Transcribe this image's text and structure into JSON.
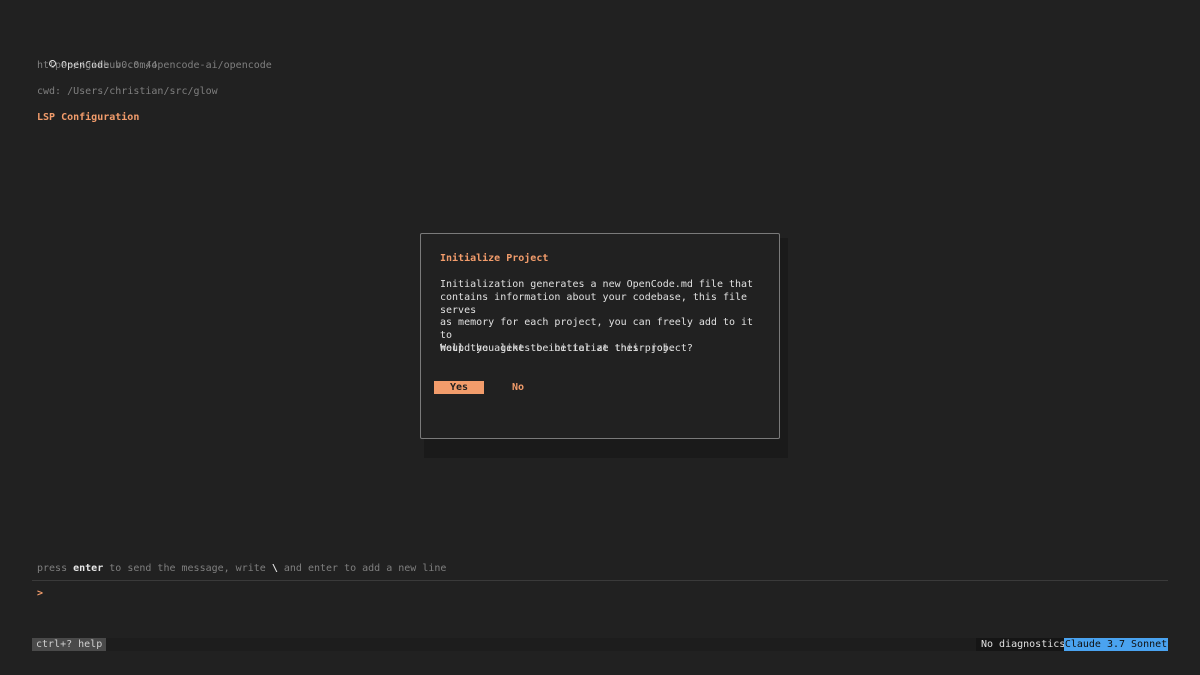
{
  "header": {
    "app_name": "OpenCode",
    "version": "v0.0.44",
    "url": "https://github.com/opencode-ai/opencode",
    "cwd_label": "cwd:",
    "cwd_path": "/Users/christian/src/glow",
    "section_title": "LSP Configuration"
  },
  "dialog": {
    "title": "Initialize Project",
    "body": "Initialization generates a new OpenCode.md file that\ncontains information about your codebase, this file serves\nas memory for each project, you can freely add to it to\nhelp the agents be better at their job.",
    "question": "Would you like to initialize this project?",
    "yes_label": "Yes",
    "no_label": "No"
  },
  "hint": {
    "part1": "press ",
    "key1": "enter",
    "part2": " to send the message, write ",
    "key2": "\\",
    "part3": " and enter to add a new line"
  },
  "prompt": {
    "caret": ">",
    "value": "",
    "placeholder": ""
  },
  "status": {
    "help": "ctrl+? help",
    "diagnostics": "No diagnostics",
    "model": "Claude 3.7 Sonnet"
  },
  "colors": {
    "accent": "#f29c6b",
    "background": "#212121",
    "model_badge": "#4aa3f0"
  }
}
